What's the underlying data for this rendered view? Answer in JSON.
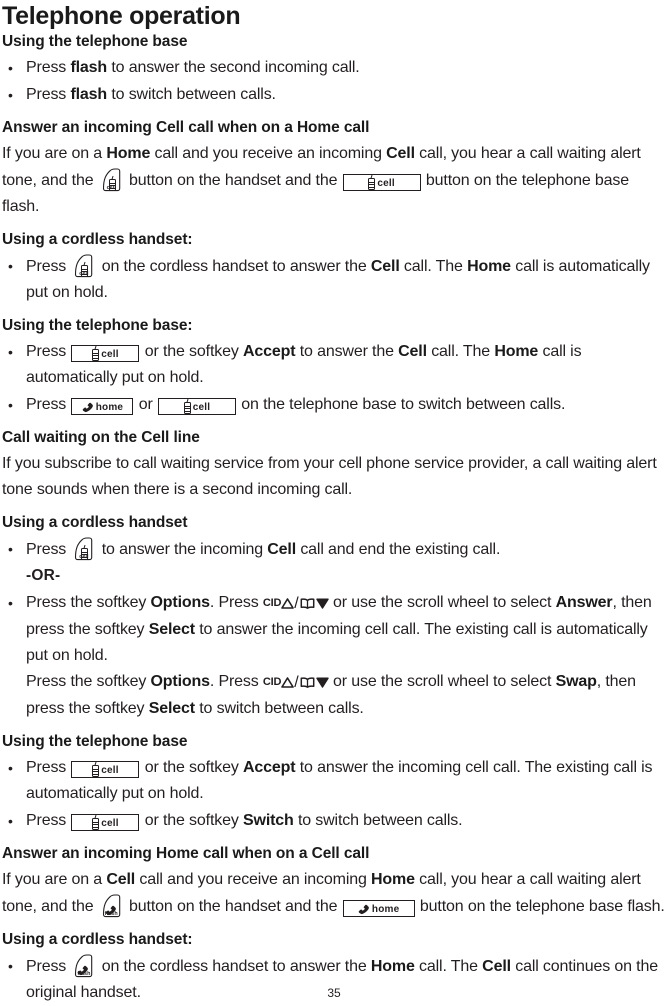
{
  "document": {
    "title": "Telephone operation",
    "page_number": "35"
  },
  "sections": [
    {
      "id": "using-telephone-base-1",
      "heading": "Using the telephone base",
      "bullets": [
        {
          "pre": "Press ",
          "bold1": "flash",
          "post": " to answer the second incoming call."
        },
        {
          "pre": "Press ",
          "bold1": "flash",
          "post": " to switch between calls."
        }
      ]
    },
    {
      "id": "answer-cell-on-home",
      "heading": "Answer an incoming Cell call when on a Home call",
      "paragraph": {
        "p1": "If you are on a ",
        "b1": "Home",
        "p2": " call and you receive an incoming ",
        "b2": "Cell",
        "p3": " call, you hear a call waiting alert tone, and the ",
        "p4": " button on the handset and the ",
        "p5": " button on the telephone base flash."
      }
    },
    {
      "id": "using-cordless-handset-1",
      "heading": "Using a cordless handset:",
      "bullet": {
        "p1": "Press ",
        "p2": " on the cordless handset to answer the ",
        "b1": "Cell",
        "p3": " call. The ",
        "b2": "Home",
        "p4": " call is automatically put on hold."
      }
    },
    {
      "id": "using-telephone-base-2",
      "heading": "Using the telephone base:",
      "bullets": [
        {
          "p1": "Press ",
          "p2": " or the softkey ",
          "b1": "Accept",
          "p3": " to answer the ",
          "b2": "Cell",
          "p4": " call. The ",
          "b3": "Home",
          "p5": " call is automatically put on hold."
        },
        {
          "p1": "Press ",
          "p2": " or ",
          "p3": " on the telephone base to switch between calls."
        }
      ]
    },
    {
      "id": "call-waiting-cell-line",
      "heading": "Call waiting on the Cell line",
      "paragraph": "If you subscribe to call waiting service from your cell phone service provider, a call waiting alert tone sounds when there is a second incoming call."
    },
    {
      "id": "using-cordless-handset-2",
      "heading": "Using a cordless handset",
      "bullets": [
        {
          "p1": "Press ",
          "p2": " to answer the incoming ",
          "b1": "Cell",
          "p3": " call and end the existing call.",
          "or": "-OR-"
        },
        {
          "p1": "Press the softkey ",
          "b1": "Options",
          "p2": ". Press ",
          "p3": " or use the scroll wheel to select ",
          "b2": "Answer",
          "p4": ", then press the softkey ",
          "b3": "Select",
          "p5": " to answer the incoming cell call. The existing call is automatically put on hold.",
          "l2_p1": "Press the softkey ",
          "l2_b1": "Options",
          "l2_p2": ". Press ",
          "l2_p3": " or use the scroll wheel to select ",
          "l2_b2": "Swap",
          "l2_p4": ", then press the softkey ",
          "l2_b3": "Select",
          "l2_p5": " to switch between calls."
        }
      ]
    },
    {
      "id": "using-telephone-base-3",
      "heading": "Using the telephone base",
      "bullets": [
        {
          "p1": "Press ",
          "p2": " or the softkey ",
          "b1": "Accept",
          "p3": " to answer the incoming cell call. The existing call is automatically put on hold."
        },
        {
          "p1": "Press ",
          "p2": " or the softkey ",
          "b1": "Switch",
          "p3": " to switch between calls."
        }
      ]
    },
    {
      "id": "answer-home-on-cell",
      "heading": "Answer an incoming Home call when on a Cell call",
      "paragraph": {
        "p1": "If you are on a ",
        "b1": "Cell",
        "p2": " call and you receive an incoming ",
        "b2": "Home",
        "p3": " call, you hear a call waiting alert tone, and the ",
        "p4": " button on the handset and the ",
        "p5": " button on the telephone base flash."
      }
    },
    {
      "id": "using-cordless-handset-3",
      "heading": "Using a cordless handset:",
      "bullet": {
        "p1": "Press ",
        "p2": " on the cordless handset to answer the ",
        "b1": "Home",
        "p3": " call. The ",
        "b2": "Cell",
        "p4": " call continues on the original handset."
      }
    }
  ],
  "keys": {
    "cell_label": "cell",
    "home_label": "home",
    "flash_label": "flash",
    "cid_label": "CID"
  },
  "colors": {
    "text": "#231f20",
    "heading": "#1a1a1a",
    "background": "#ffffff"
  }
}
